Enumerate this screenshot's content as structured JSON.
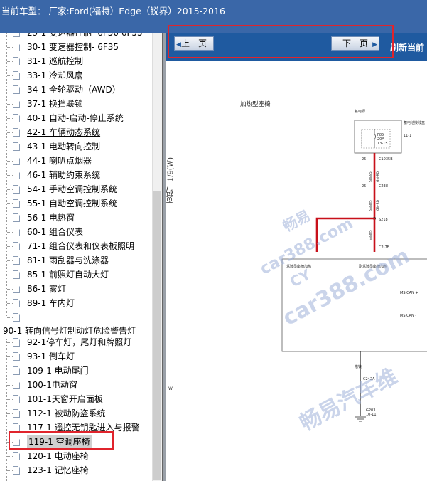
{
  "window": {
    "title": "当前车型： 厂家:Ford(福特）Edge（锐界）2015-2016"
  },
  "tree": {
    "items": [
      {
        "label": "29-1 变速器控制- 6F50 6F55"
      },
      {
        "label": "30-1 变速器控制- 6F35"
      },
      {
        "label": "31-1 巡航控制"
      },
      {
        "label": "33-1 冷却风扇"
      },
      {
        "label": "34-1 全轮驱动（AWD）"
      },
      {
        "label": "37-1 换挡联锁"
      },
      {
        "label": "40-1 自动-启动-停止系统"
      },
      {
        "label": "42-1 车辆动态系统"
      },
      {
        "label": "43-1 电动转向控制"
      },
      {
        "label": "44-1 喇叭点烟器"
      },
      {
        "label": "46-1 辅助约束系统"
      },
      {
        "label": "54-1 手动空调控制系统"
      },
      {
        "label": "55-1 自动空调控制系统"
      },
      {
        "label": "56-1 电热窗"
      },
      {
        "label": "60-1 组合仪表"
      },
      {
        "label": "71-1 组合仪表和仪表板照明"
      },
      {
        "label": "81-1 雨刮器与洗涤器"
      },
      {
        "label": "85-1 前照灯自动大灯"
      },
      {
        "label": "86-1 雾灯"
      },
      {
        "label": "89-1 车内灯"
      },
      {
        "label": ""
      },
      {
        "label": "90-1 转向信号灯制动灯危险警告灯"
      },
      {
        "label": "92-1停车灯，尾灯和牌照灯"
      },
      {
        "label": "93-1 倒车灯"
      },
      {
        "label": "109-1 电动尾门"
      },
      {
        "label": "100-1电动窗"
      },
      {
        "label": "101-1天窗开启面板"
      },
      {
        "label": "112-1 被动防盗系统"
      },
      {
        "label": "117-1 遥控无钥匙进入与报警"
      },
      {
        "label": "119-1 空调座椅"
      },
      {
        "label": "120-1 电动座椅"
      },
      {
        "label": "123-1 记忆座椅"
      }
    ]
  },
  "nav": {
    "prev_label": "上一页",
    "next_label": "下一页",
    "refresh_label": "刷新当前"
  },
  "document": {
    "side_caption": "页码，1/9(W)",
    "diagram_title": "加热型座椅",
    "source_label": "蓄电源",
    "dist_box_label": "蓄电池接线盒",
    "dist_box_ref": "11-1",
    "fuse_id": "F85",
    "fuse_rating": "20A",
    "fuse_ref": "13-15",
    "connector_1": "C1035B",
    "wire_1": "SBB85",
    "wire_1_color": "GN-RD",
    "connector_2": "C238",
    "wire_2": "SBB85",
    "wire_2_color": "GN-RD",
    "splice": "S218",
    "wire_3": "SBB85",
    "connector_3": "C2-7B",
    "module_left": "驾驶员座椅加热",
    "module_right": "副驾驶员座椅加热",
    "ms_can_plus": "MS CAN +",
    "ms_can_minus": "MS CAN -",
    "ground_label": "搭铁",
    "connector_4": "C242A",
    "ground_ref": "G203",
    "ground_page": "10-11",
    "bottom_mark": "W",
    "watermark_1": "畅易",
    "watermark_2": "car388.com",
    "watermark_3": "CY",
    "watermark_4": "car388.com",
    "watermark_5": "畅易汽车维"
  },
  "colors": {
    "title_bg": "#3a67a8",
    "nav_bg": "#1f5aa0",
    "highlight_red": "#e0242c",
    "wire_red": "#c8101a",
    "watermark": "#9fb0d8"
  }
}
